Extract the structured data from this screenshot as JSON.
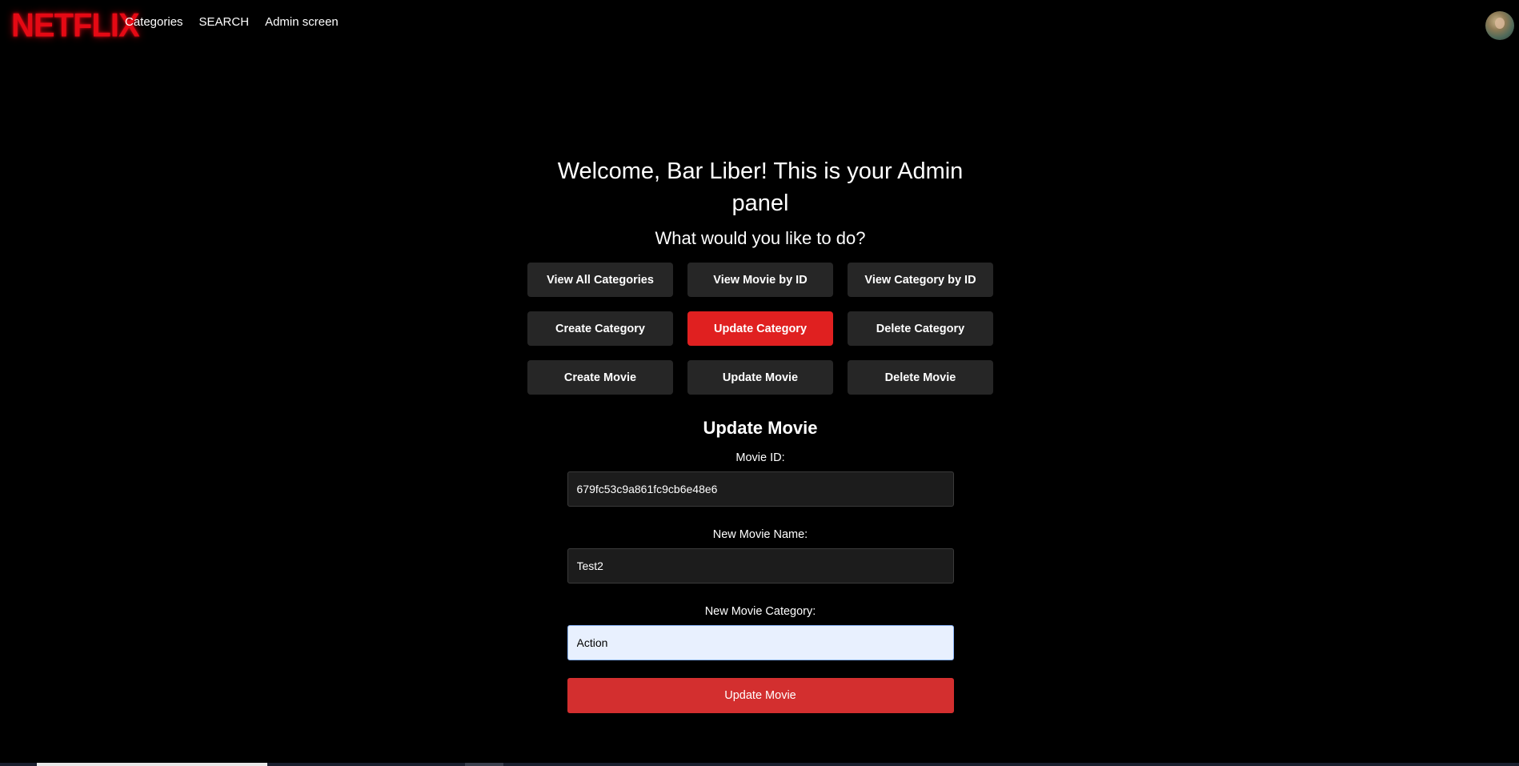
{
  "nav": {
    "logo": "NETFLIX",
    "links": [
      "Categories",
      "SEARCH",
      "Admin screen"
    ],
    "avatar_icon": "user-avatar-icon"
  },
  "panel": {
    "welcome": "Welcome, Bar Liber! This is your Admin panel",
    "prompt": "What would you like to do?",
    "actions": [
      "View All Categories",
      "View Movie by ID",
      "View Category by ID",
      "Create Category",
      "Update Category",
      "Delete Category",
      "Create Movie",
      "Update Movie",
      "Delete Movie"
    ],
    "active_action": "Update Category"
  },
  "form": {
    "title": "Update Movie",
    "movie_id_label": "Movie ID:",
    "movie_id_value": "679fc53c9a861fc9cb6e48e6",
    "name_label": "New Movie Name:",
    "name_value": "Test2",
    "category_label": "New Movie Category:",
    "category_value": "Action",
    "submit_label": "Update Movie"
  },
  "colors": {
    "brand_red": "#e50914",
    "active_button": "#e02020",
    "submit_button": "#d32f2f",
    "button_bg": "#262626",
    "background": "#000000"
  }
}
